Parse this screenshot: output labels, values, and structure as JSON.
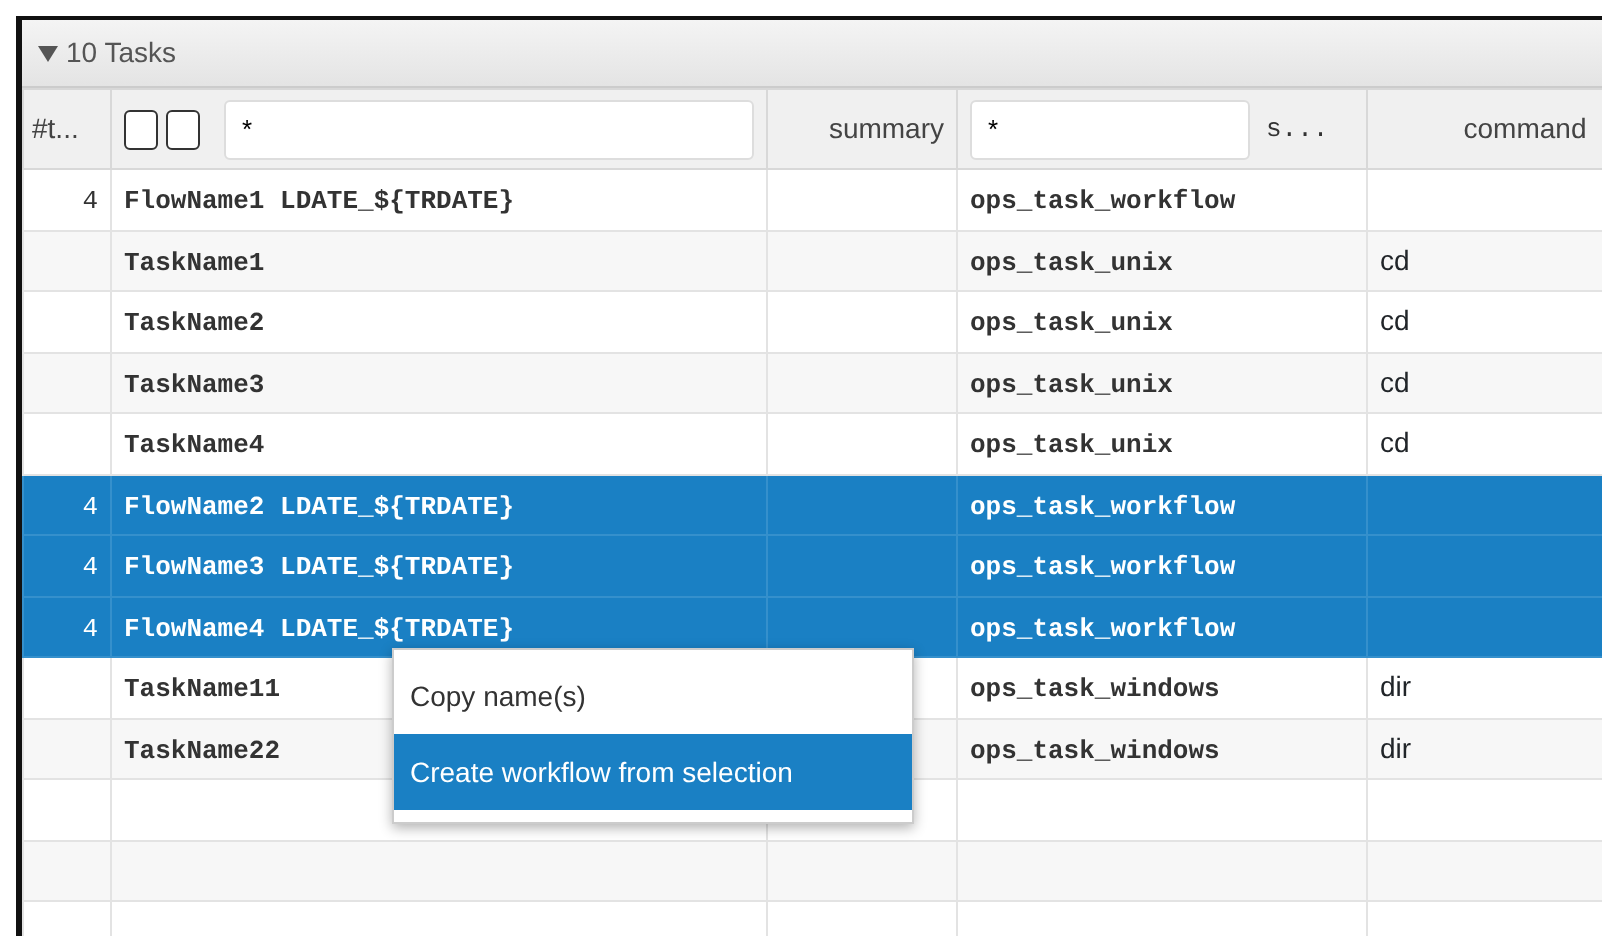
{
  "panel": {
    "title": "10 Tasks",
    "expanded": true
  },
  "columns": {
    "column_1": "#t...",
    "checkboxes": [
      {
        "checked": false
      },
      {
        "checked": false
      }
    ],
    "name_filter": {
      "value": "*"
    },
    "summary": "summary",
    "type_filter": {
      "value": "*"
    },
    "type_label": "s...",
    "command": "command"
  },
  "rows": [
    {
      "count": "4",
      "name": "FlowName1 LDATE_${TRDATE}",
      "type": "ops_task_workflow",
      "command": "",
      "selected": false
    },
    {
      "count": "",
      "name": "TaskName1",
      "type": "ops_task_unix",
      "command": "cd",
      "selected": false
    },
    {
      "count": "",
      "name": "TaskName2",
      "type": "ops_task_unix",
      "command": "cd",
      "selected": false
    },
    {
      "count": "",
      "name": "TaskName3",
      "type": "ops_task_unix",
      "command": "cd",
      "selected": false
    },
    {
      "count": "",
      "name": "TaskName4",
      "type": "ops_task_unix",
      "command": "cd",
      "selected": false
    },
    {
      "count": "4",
      "name": "FlowName2 LDATE_${TRDATE}",
      "type": "ops_task_workflow",
      "command": "",
      "selected": true
    },
    {
      "count": "4",
      "name": "FlowName3 LDATE_${TRDATE}",
      "type": "ops_task_workflow",
      "command": "",
      "selected": true
    },
    {
      "count": "4",
      "name": "FlowName4 LDATE_${TRDATE}",
      "type": "ops_task_workflow",
      "command": "",
      "selected": true
    },
    {
      "count": "",
      "name": "TaskName11",
      "type": "ops_task_windows",
      "command": "dir",
      "selected": false
    },
    {
      "count": "",
      "name": "TaskName22",
      "type": "ops_task_windows",
      "command": "dir",
      "selected": false
    }
  ],
  "context_menu": [
    {
      "label": "Copy name(s)",
      "selected": false
    },
    {
      "label": "Create workflow from selection",
      "selected": true
    }
  ]
}
